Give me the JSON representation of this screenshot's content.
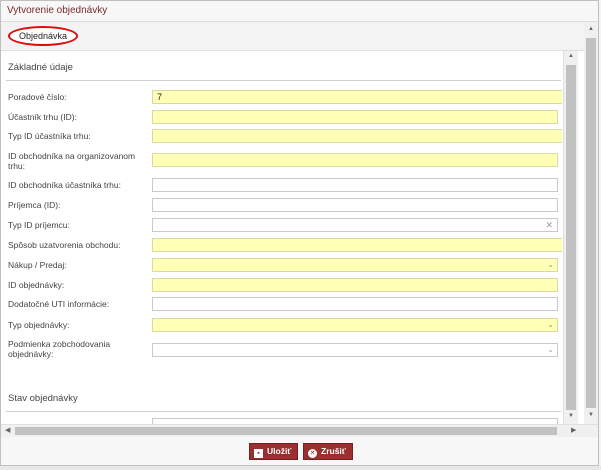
{
  "dialog": {
    "title": "Vytvorenie objednávky"
  },
  "tabs": [
    {
      "label": "Objednávka"
    }
  ],
  "sections": {
    "basic_title": "Základné údaje",
    "status_title": "Stav objednávky"
  },
  "fields": [
    {
      "label": "Poradové číslo:",
      "value": "7"
    },
    {
      "label": "Účastník trhu (ID):",
      "value": ""
    },
    {
      "label": "Typ ID účastníka trhu:",
      "value": ""
    },
    {
      "label": "ID obchodníka na organizovanom trhu:",
      "value": ""
    },
    {
      "label": "ID obchodníka účastníka trhu:",
      "value": ""
    },
    {
      "label": "Príjemca (ID):",
      "value": ""
    },
    {
      "label": "Typ ID príjemcu:",
      "value": ""
    },
    {
      "label": "Spôsob uzatvorenia obchodu:",
      "value": ""
    },
    {
      "label": "Nákup / Predaj:",
      "value": ""
    },
    {
      "label": "ID objednávky:",
      "value": ""
    },
    {
      "label": "Dodatočné UTI informácie:",
      "value": ""
    },
    {
      "label": "Typ objednávky:",
      "value": ""
    },
    {
      "label": "Podmienka zobchodovania objednávky:",
      "value": ""
    }
  ],
  "buttons": {
    "save": "Uložiť",
    "cancel": "Zrušiť"
  },
  "colors": {
    "required_field": "#ffffb5",
    "button": "#9b2f2f",
    "tab_highlight": "#e10b0b"
  }
}
